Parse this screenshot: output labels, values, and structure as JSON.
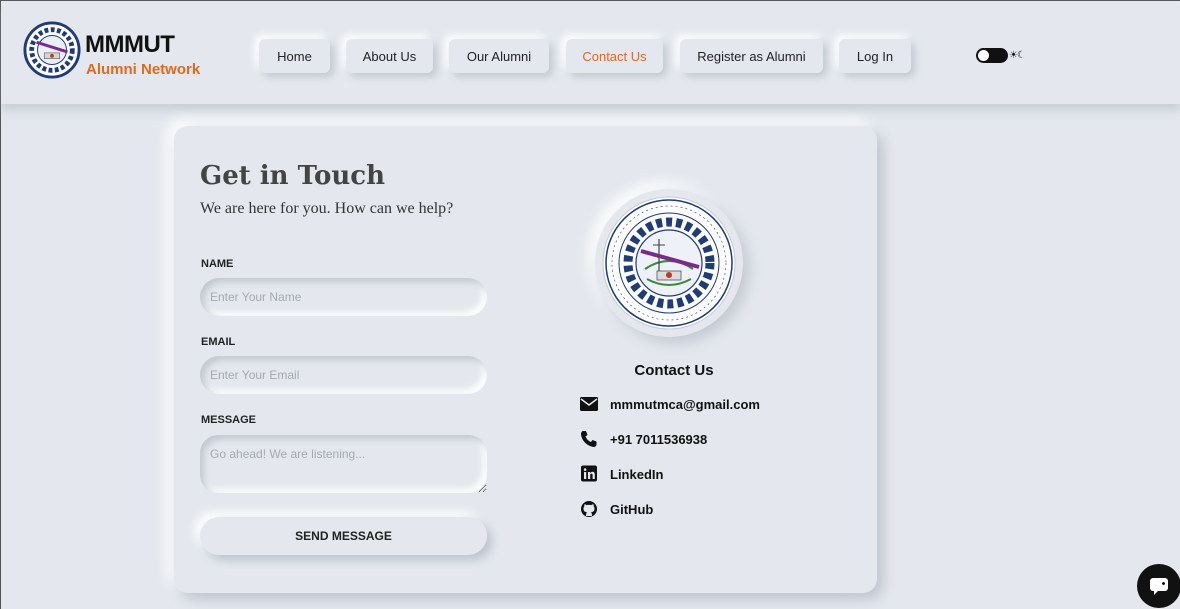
{
  "navbar": {
    "brand_title": "MMMUT",
    "brand_subtitle": "Alumni Network",
    "links": {
      "home": "Home",
      "about": "About Us",
      "alumni": "Our Alumni",
      "contact": "Contact Us",
      "register": "Register as Alumni",
      "login": "Log In"
    },
    "active_link": "Contact Us",
    "accent_color": "#e06a1c",
    "theme_toggle_icons": "☀☾"
  },
  "form": {
    "heading": "Get in Touch",
    "subheading": "We are here for you. How can we help?",
    "name_label": "NAME",
    "name_placeholder": "Enter Your Name",
    "email_label": "EMAIL",
    "email_placeholder": "Enter Your Email",
    "message_label": "MESSAGE",
    "message_placeholder": "Go ahead! We are listening...",
    "submit_label": "SEND MESSAGE"
  },
  "contact": {
    "title": "Contact Us",
    "email": "mmmutmca@gmail.com",
    "phone": "+91 7011536938",
    "linkedin": "LinkedIn",
    "github": "GitHub"
  },
  "icons": [
    "mail-icon",
    "phone-icon",
    "linkedin-icon",
    "github-icon",
    "chat-icon",
    "sun-icon",
    "moon-icon"
  ]
}
